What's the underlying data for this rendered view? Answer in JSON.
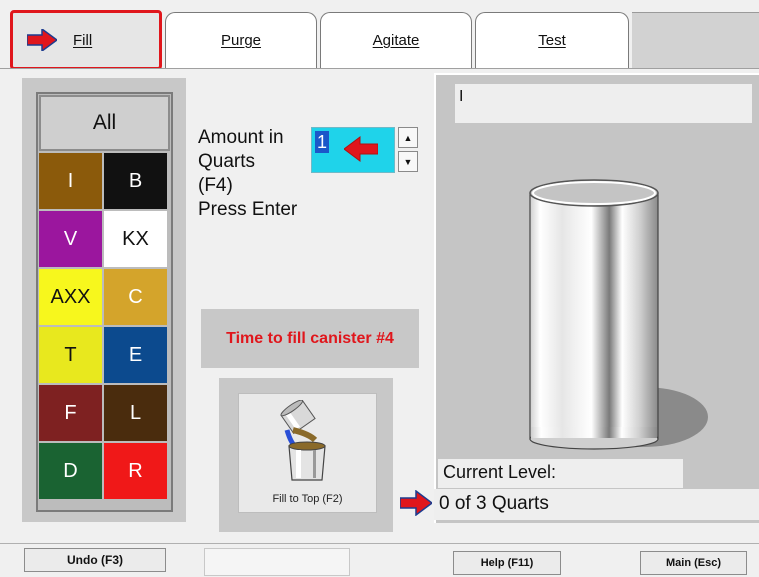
{
  "tabs": [
    {
      "label": "Fill"
    },
    {
      "label": "Purge"
    },
    {
      "label": "Agitate"
    },
    {
      "label": "Test"
    }
  ],
  "color_grid": {
    "all_label": "All",
    "colors": [
      {
        "label": "I",
        "bg": "#8b5a0b",
        "fg": "#ffffff"
      },
      {
        "label": "B",
        "bg": "#111111",
        "fg": "#ffffff"
      },
      {
        "label": "V",
        "bg": "#9b169e",
        "fg": "#ffffff"
      },
      {
        "label": "KX",
        "bg": "#ffffff",
        "fg": "#111111"
      },
      {
        "label": "AXX",
        "bg": "#f7f71d",
        "fg": "#111111"
      },
      {
        "label": "C",
        "bg": "#d4a42b",
        "fg": "#ffffff"
      },
      {
        "label": "T",
        "bg": "#e8e81e",
        "fg": "#111111"
      },
      {
        "label": "E",
        "bg": "#0c4a8e",
        "fg": "#ffffff"
      },
      {
        "label": "F",
        "bg": "#7e2121",
        "fg": "#ffffff"
      },
      {
        "label": "L",
        "bg": "#4a2c0d",
        "fg": "#ffffff"
      },
      {
        "label": "D",
        "bg": "#1a6332",
        "fg": "#ffffff"
      },
      {
        "label": "R",
        "bg": "#f01818",
        "fg": "#ffffff"
      }
    ]
  },
  "amount": {
    "label_lines": [
      "Amount in",
      "Quarts",
      "(F4)",
      "Press Enter"
    ],
    "value": "1"
  },
  "message": "Time to fill canister #4",
  "fill_to_top": {
    "label": "Fill to Top (F2)"
  },
  "right_panel": {
    "top_text": "I",
    "current_level_label": "Current Level:",
    "current_level_value": "0 of 3 Quarts"
  },
  "bottom": {
    "undo_label": "Undo (F3)",
    "help_label": "Help (F11)",
    "main_label": "Main (Esc)"
  },
  "colors": {
    "accent_red": "#e0161c",
    "input_cyan": "#1fd3ea"
  }
}
